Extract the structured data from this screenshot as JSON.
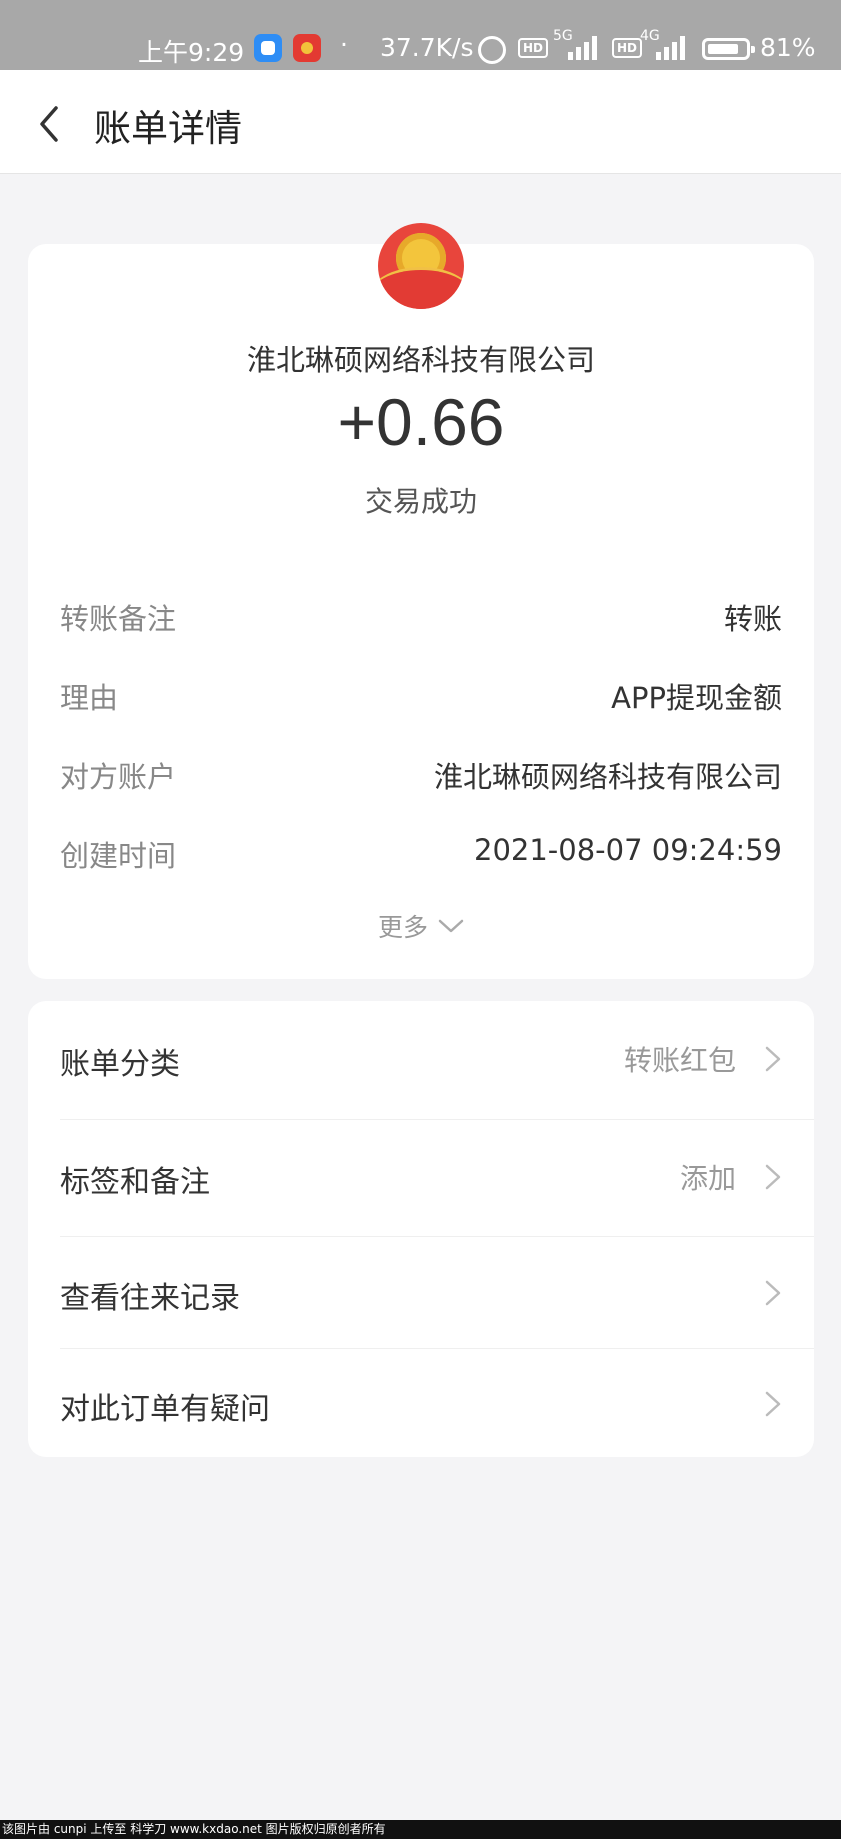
{
  "status_bar": {
    "time": "上午9:29",
    "dot": "·",
    "speed": "37.7K/s",
    "hd1": "HD",
    "net1": "5G",
    "hd2": "HD",
    "net2": "4G",
    "battery": "81%"
  },
  "nav": {
    "title": "账单详情"
  },
  "bill": {
    "merchant": "淮北琳硕网络科技有限公司",
    "amount": "+0.66",
    "status": "交易成功",
    "details": [
      {
        "label": "转账备注",
        "value": "转账"
      },
      {
        "label": "理由",
        "value": "APP提现金额"
      },
      {
        "label": "对方账户",
        "value": "淮北琳硕网络科技有限公司"
      },
      {
        "label": "创建时间",
        "value": "2021-08-07 09:24:59"
      }
    ],
    "more_label": "更多"
  },
  "menu": {
    "items": [
      {
        "label": "账单分类",
        "value": "转账红包"
      },
      {
        "label": "标签和备注",
        "value": "添加"
      },
      {
        "label": "查看往来记录",
        "value": ""
      },
      {
        "label": "对此订单有疑问",
        "value": ""
      }
    ]
  },
  "watermark": "该图片由 cunpi 上传至 科学刀 www.kxdao.net 图片版权归原创者所有"
}
